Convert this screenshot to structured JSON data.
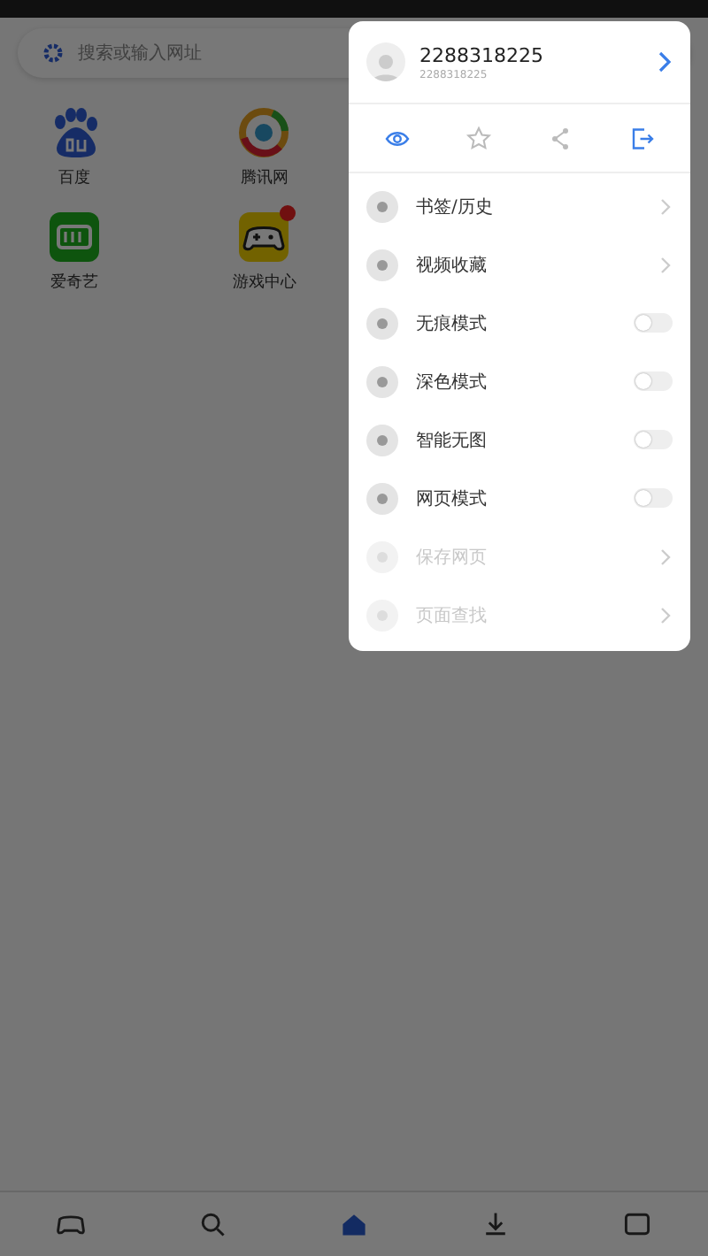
{
  "search": {
    "placeholder": "搜索或输入网址"
  },
  "shortcuts": [
    {
      "kind": "paw",
      "label": "百度",
      "badge": false
    },
    {
      "kind": "ring",
      "label": "腾讯网",
      "badge": false
    },
    {
      "kind": "tv",
      "label": "爱奇艺",
      "badge": false
    },
    {
      "kind": "gamepad",
      "label": "游戏中心",
      "badge": true
    }
  ],
  "bottom_nav": [
    {
      "kind": "gamepad",
      "selected": false
    },
    {
      "kind": "search",
      "selected": false
    },
    {
      "kind": "home",
      "selected": true
    },
    {
      "kind": "download",
      "selected": false
    },
    {
      "kind": "tabs",
      "selected": false
    }
  ],
  "menu": {
    "account": {
      "name": "2288318225",
      "id": "2288318225"
    },
    "tools": [
      {
        "kind": "eye",
        "active": true
      },
      {
        "kind": "star",
        "active": false
      },
      {
        "kind": "share",
        "active": false
      },
      {
        "kind": "exit",
        "active": true
      }
    ],
    "items": [
      {
        "kind": "link",
        "label": "书签/历史",
        "disabled": false
      },
      {
        "kind": "link",
        "label": "视频收藏",
        "disabled": false
      },
      {
        "kind": "toggle",
        "label": "无痕模式",
        "on": false,
        "disabled": false
      },
      {
        "kind": "toggle",
        "label": "深色模式",
        "on": false,
        "disabled": false
      },
      {
        "kind": "toggle",
        "label": "智能无图",
        "on": false,
        "disabled": false
      },
      {
        "kind": "toggle",
        "label": "网页模式",
        "on": false,
        "disabled": false
      },
      {
        "kind": "link",
        "label": "保存网页",
        "disabled": true
      },
      {
        "kind": "link",
        "label": "页面查找",
        "disabled": true
      }
    ]
  }
}
